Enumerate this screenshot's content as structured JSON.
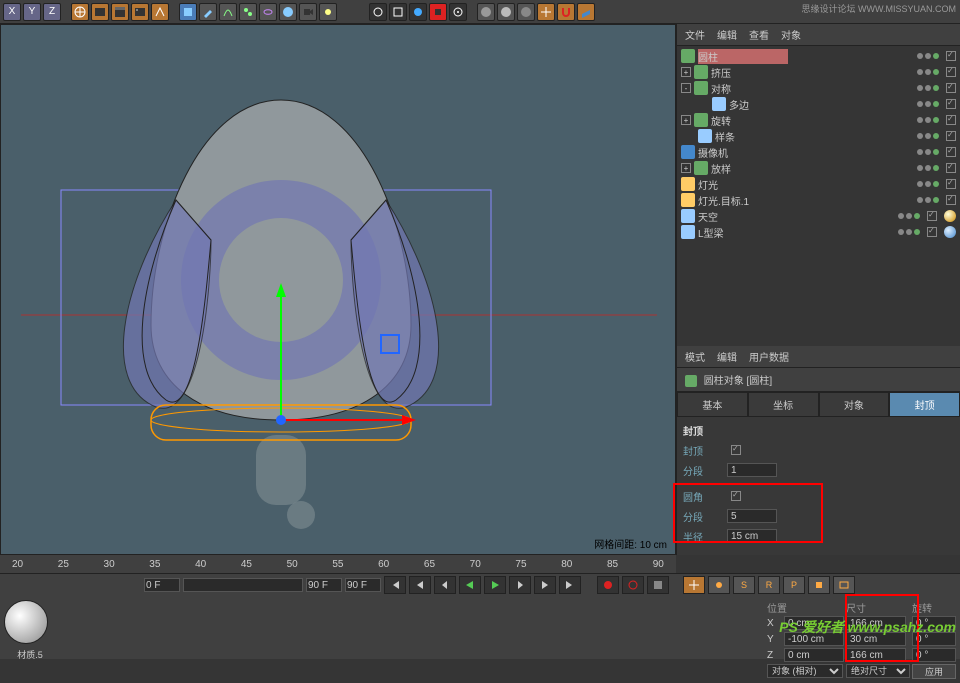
{
  "watermark_top": "思缘设计论坛  WWW.MISSYUAN.COM",
  "watermark_bottom": "PS 爱好者  www.psahz.com",
  "topmenu": {
    "file": "文件",
    "edit": "编辑",
    "view": "查看",
    "object": "对象"
  },
  "toolbar": {
    "axis_x": "X",
    "axis_y": "Y",
    "axis_z": "Z"
  },
  "viewport": {
    "grid_label": "网格间距: 10 cm"
  },
  "ruler": [
    "20",
    "25",
    "30",
    "35",
    "40",
    "45",
    "50",
    "55",
    "60",
    "65",
    "70",
    "75",
    "80",
    "85",
    "90"
  ],
  "timeline": {
    "start": "0 F",
    "end": "90 F",
    "cur": "90 F"
  },
  "coords": {
    "pos_label": "位置",
    "size_label": "尺寸",
    "rot_label": "旋转",
    "x": "0 cm",
    "y": "-100 cm",
    "z": "0 cm",
    "sx": "166 cm",
    "sy": "30 cm",
    "sz": "166 cm",
    "rx": "0 °",
    "ry": "0 °",
    "rz": "0 °",
    "obj_label": "对象 (相对)",
    "abs_label": "绝对尺寸",
    "apply": "应用"
  },
  "hierarchy": [
    {
      "name": "圆柱",
      "icon": "#6a6",
      "indent": 0,
      "sel": true
    },
    {
      "name": "挤压",
      "icon": "#6a6",
      "indent": 0,
      "toggle": "+"
    },
    {
      "name": "对称",
      "icon": "#6a6",
      "indent": 0,
      "toggle": "-"
    },
    {
      "name": "多边",
      "icon": "#9cf",
      "indent": 2
    },
    {
      "name": "旋转",
      "icon": "#6a6",
      "indent": 0,
      "toggle": "+"
    },
    {
      "name": "样条",
      "icon": "#9cf",
      "indent": 1
    },
    {
      "name": "摄像机",
      "icon": "#48c",
      "indent": 0
    },
    {
      "name": "放样",
      "icon": "#6a6",
      "indent": 0,
      "toggle": "+"
    },
    {
      "name": "灯光",
      "icon": "#fc6",
      "indent": 0
    },
    {
      "name": "灯光.目标.1",
      "icon": "#fc6",
      "indent": 0
    },
    {
      "name": "天空",
      "icon": "#9cf",
      "indent": 0,
      "tag": "orange"
    },
    {
      "name": "L型梁",
      "icon": "#9cf",
      "indent": 0,
      "tag": "blue"
    }
  ],
  "attr": {
    "mode": "模式",
    "edit": "编辑",
    "userdata": "用户数据",
    "title": "圆柱对象 [圆柱]",
    "tabs": {
      "basic": "基本",
      "coord": "坐标",
      "object": "对象",
      "cap": "封顶"
    },
    "section": "封顶",
    "cap_label": "封顶",
    "cap_checked": true,
    "seg_label": "分段",
    "seg_val": "1",
    "fillet_label": "圆角",
    "fillet_checked": true,
    "fseg_label": "分段",
    "fseg_val": "5",
    "radius_label": "半径",
    "radius_val": "15 cm"
  },
  "material_label": "材质.5"
}
